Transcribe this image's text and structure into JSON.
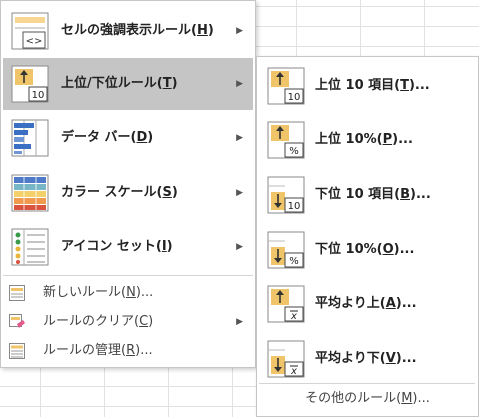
{
  "colors": {
    "hover_bg": "#c5c5c5",
    "accent_gold": "#e9b04d",
    "menu_border": "#c6c6c6"
  },
  "main_menu": {
    "items": [
      {
        "label": "セルの強調表示ルール(",
        "key": "H",
        "close": ")",
        "icon": "highlight-cells-icon"
      },
      {
        "label": "上位/下位ルール(",
        "key": "T",
        "close": ")",
        "icon": "top-bottom-rules-icon"
      },
      {
        "label": "データ バー(",
        "key": "D",
        "close": ")",
        "icon": "data-bars-icon"
      },
      {
        "label": "カラー スケール(",
        "key": "S",
        "close": ")",
        "icon": "color-scales-icon"
      },
      {
        "label": "アイコン セット(",
        "key": "I",
        "close": ")",
        "icon": "icon-sets-icon"
      }
    ],
    "small_items": [
      {
        "label": "新しいルール(",
        "key": "N",
        "close": ")...",
        "icon": "new-rule-icon"
      },
      {
        "label": "ルールのクリア(",
        "key": "C",
        "close": ")",
        "icon": "clear-rules-icon"
      },
      {
        "label": "ルールの管理(",
        "key": "R",
        "close": ")...",
        "icon": "manage-rules-icon"
      }
    ]
  },
  "submenu": {
    "items": [
      {
        "label": "上位 10 項目(",
        "key": "T",
        "close": ")...",
        "icon": "top-10-items-icon"
      },
      {
        "label": "上位 10%(",
        "key": "P",
        "close": ")...",
        "icon": "top-10-percent-icon"
      },
      {
        "label": "下位 10 項目(",
        "key": "B",
        "close": ")...",
        "icon": "bottom-10-items-icon"
      },
      {
        "label": "下位 10%(",
        "key": "O",
        "close": ")...",
        "icon": "bottom-10-percent-icon"
      },
      {
        "label": "平均より上(",
        "key": "A",
        "close": ")...",
        "icon": "above-average-icon"
      },
      {
        "label": "平均より下(",
        "key": "V",
        "close": ")...",
        "icon": "below-average-icon"
      }
    ],
    "footer": {
      "label": "その他のルール(",
      "key": "M",
      "close": ")..."
    },
    "icon_texts": {
      "ten": "10",
      "percent": "%",
      "xbar": "x"
    }
  }
}
